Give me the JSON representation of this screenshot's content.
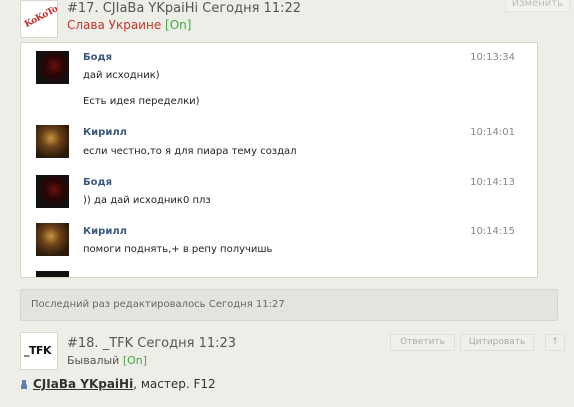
{
  "post17": {
    "avatar_text": "KoKoToc",
    "title": "#17. CJIaBa YKpaiHi Сегодня 11:22",
    "status": "Слава Украине",
    "online": "[On]",
    "edit_button": "Изменить"
  },
  "chat": {
    "messages": [
      {
        "author": "Бодя",
        "time": "10:13:34",
        "lines": [
          "дай исходник)",
          "Есть идея переделки)"
        ]
      },
      {
        "author": "Кирилл",
        "time": "10:14:01",
        "lines": [
          "если честно,то я для пиара тему создал"
        ]
      },
      {
        "author": "Бодя",
        "time": "10:14:13",
        "lines": [
          ")) да дай исходник0 плз"
        ]
      },
      {
        "author": "Кирилл",
        "time": "10:14:15",
        "lines": [
          "помоги поднять,+ в репу получишь"
        ]
      }
    ]
  },
  "edited_note": "Последний раз редактировалось Сегодня 11:27",
  "post18": {
    "avatar_text": "_TFK",
    "title": "#18. _TFK Сегодня 11:23",
    "rank": "Бывалый",
    "online": "[On]",
    "reply_button": "Ответить",
    "quote_button": "Цитировать",
    "more_button": "↑"
  },
  "reply_line": {
    "username": "CJIaBa YKpaiHi",
    "text": ", мастер. F12"
  }
}
